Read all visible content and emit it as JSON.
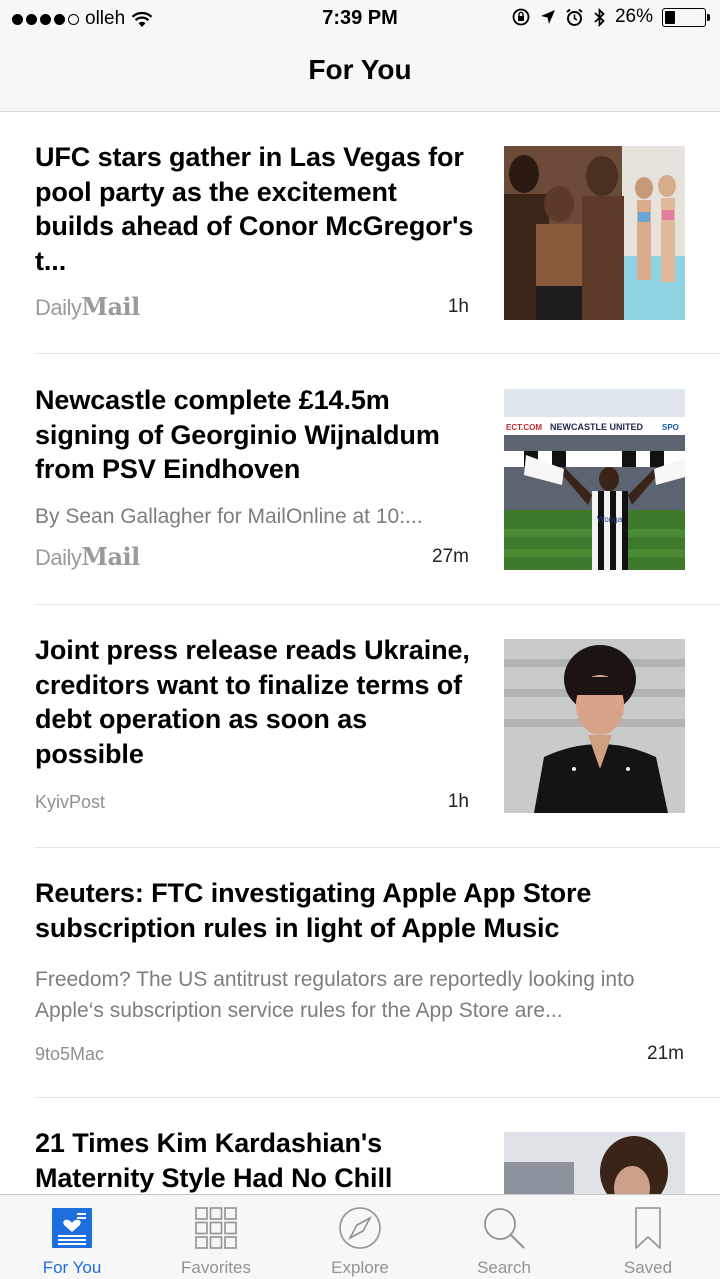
{
  "status_bar": {
    "carrier": "olleh",
    "time": "7:39 PM",
    "battery": "26%",
    "battery_level": 0.26,
    "signal_bars": 4,
    "signal_max": 5
  },
  "nav": {
    "title": "For You"
  },
  "articles": [
    {
      "headline": "UFC stars gather in Las Vegas for pool party as the excitement builds ahead of Conor McGregor's t...",
      "summary": "",
      "source_light": "Daily",
      "source_bold": "Mail",
      "time": "1h"
    },
    {
      "headline": "Newcastle complete £14.5m signing of Georginio Wijnaldum from PSV Eindhoven",
      "summary": "By Sean Gallagher for MailOnline at 10:...",
      "source_light": "Daily",
      "source_bold": "Mail",
      "time": "27m",
      "image_banner": "NEWCASTLE UNITED",
      "image_banner_left": "ECT.COM",
      "image_banner_right": "SPO",
      "image_shirt": "Wonga"
    },
    {
      "headline": "Joint press release reads Ukraine, creditors want to finalize terms of debt operation as soon as possible",
      "summary": "",
      "source": "KyivPost",
      "time": "1h"
    },
    {
      "headline": "Reuters: FTC investigating Apple App Store subscription rules in light of Apple Music",
      "summary": "Freedom? The US antitrust regulators are reportedly looking into Apple‘s subscription service rules for the App Store are...",
      "source": "9to5Mac",
      "time": "21m"
    },
    {
      "headline": "21 Times Kim Kardashian's Maternity Style Had No Chill",
      "summary": "",
      "source": "",
      "time": ""
    }
  ],
  "tabs": [
    {
      "label": "For You",
      "icon": "news-icon",
      "active": true
    },
    {
      "label": "Favorites",
      "icon": "grid-icon",
      "active": false
    },
    {
      "label": "Explore",
      "icon": "compass-icon",
      "active": false
    },
    {
      "label": "Search",
      "icon": "search-icon",
      "active": false
    },
    {
      "label": "Saved",
      "icon": "bookmark-icon",
      "active": false
    }
  ],
  "colors": {
    "accent": "#1d6fe0",
    "inactive": "#929292",
    "bar_background": "#f7f7f7"
  }
}
